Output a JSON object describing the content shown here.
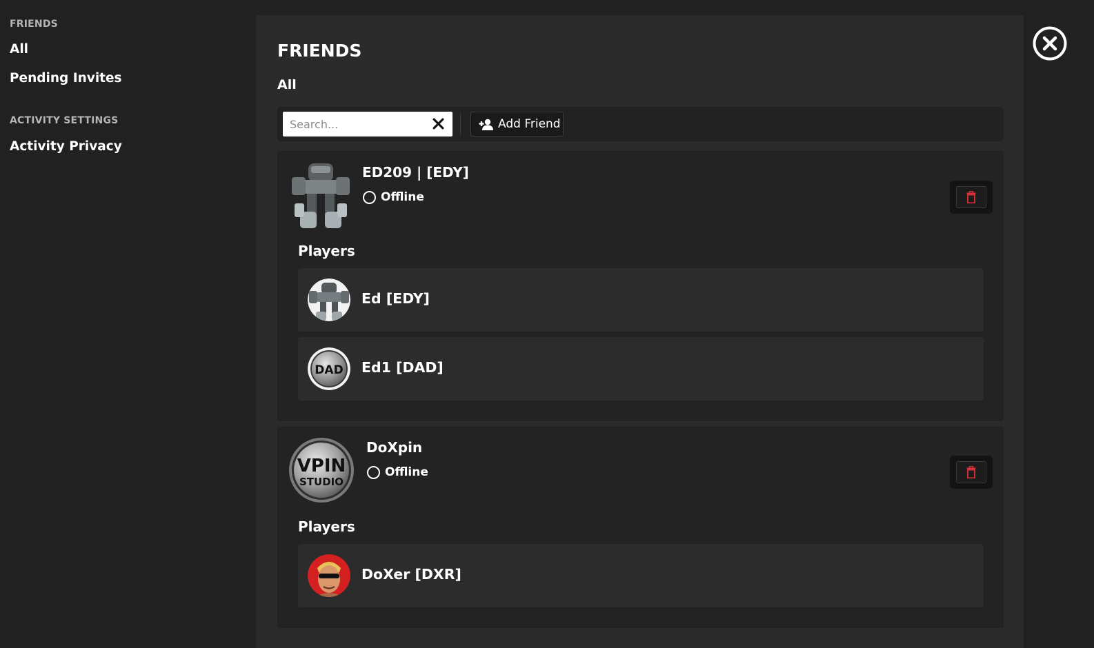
{
  "sidebar": {
    "section_friends": "FRIENDS",
    "item_all": "All",
    "item_pending": "Pending Invites",
    "section_activity": "ACTIVITY SETTINGS",
    "item_privacy": "Activity Privacy"
  },
  "main": {
    "title": "FRIENDS",
    "subtitle": "All",
    "search_placeholder": "Search...",
    "add_friend_label": "Add Friend"
  },
  "friends": [
    {
      "name": "ED209 | [EDY]",
      "status": "Offline",
      "avatar": "robot-avatar",
      "players_label": "Players",
      "players": [
        {
          "name": "Ed [EDY]",
          "avatar": "robot-avatar"
        },
        {
          "name": "Ed1 [DAD]",
          "avatar": "dad-badge-avatar",
          "badge_text": "DAD"
        }
      ]
    },
    {
      "name": "DoXpin",
      "status": "Offline",
      "avatar": "vpin-studio-avatar",
      "avatar_text_1": "VPIN",
      "avatar_text_2": "STUDIO",
      "players_label": "Players",
      "players": [
        {
          "name": "DoXer [DXR]",
          "avatar": "face-avatar"
        }
      ]
    }
  ],
  "colors": {
    "background": "#212121",
    "panel": "#2b2b2b",
    "card": "#232323",
    "row": "#2c2c2c",
    "delete_icon": "#e0313b"
  },
  "icons": [
    "close-circle-icon",
    "clear-x-icon",
    "add-person-icon",
    "trash-icon",
    "status-offline-icon"
  ]
}
